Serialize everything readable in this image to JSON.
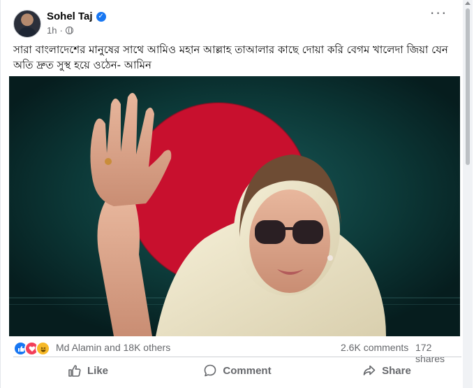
{
  "post": {
    "author": "Sohel Taj",
    "time": "1h",
    "caption": "সারা বাংলাদেশের মানুষের সাথে আমিও মহান আল্লাহ তাআলার কাছে দোয়া করি বেগম খালেদা জিয়া যেন অতি দ্রুত সুস্থ হয়ে ওঠেন- আমিন",
    "more_label": "···"
  },
  "engagement": {
    "reactors": "Md Alamin and 18K others",
    "comments": "2.6K comments",
    "shares": "172 shares",
    "reaction_icons": [
      "like-icon",
      "love-icon",
      "haha-icon"
    ]
  },
  "actions": {
    "like": "Like",
    "comment": "Comment",
    "share": "Share"
  },
  "icons": {
    "verified": "verified-badge-icon",
    "privacy": "globe-icon"
  },
  "colors": {
    "brand_blue": "#1877f2",
    "secondary_text": "#65676b",
    "image_bg": "#0b3434",
    "flag_red": "#c8102e"
  }
}
